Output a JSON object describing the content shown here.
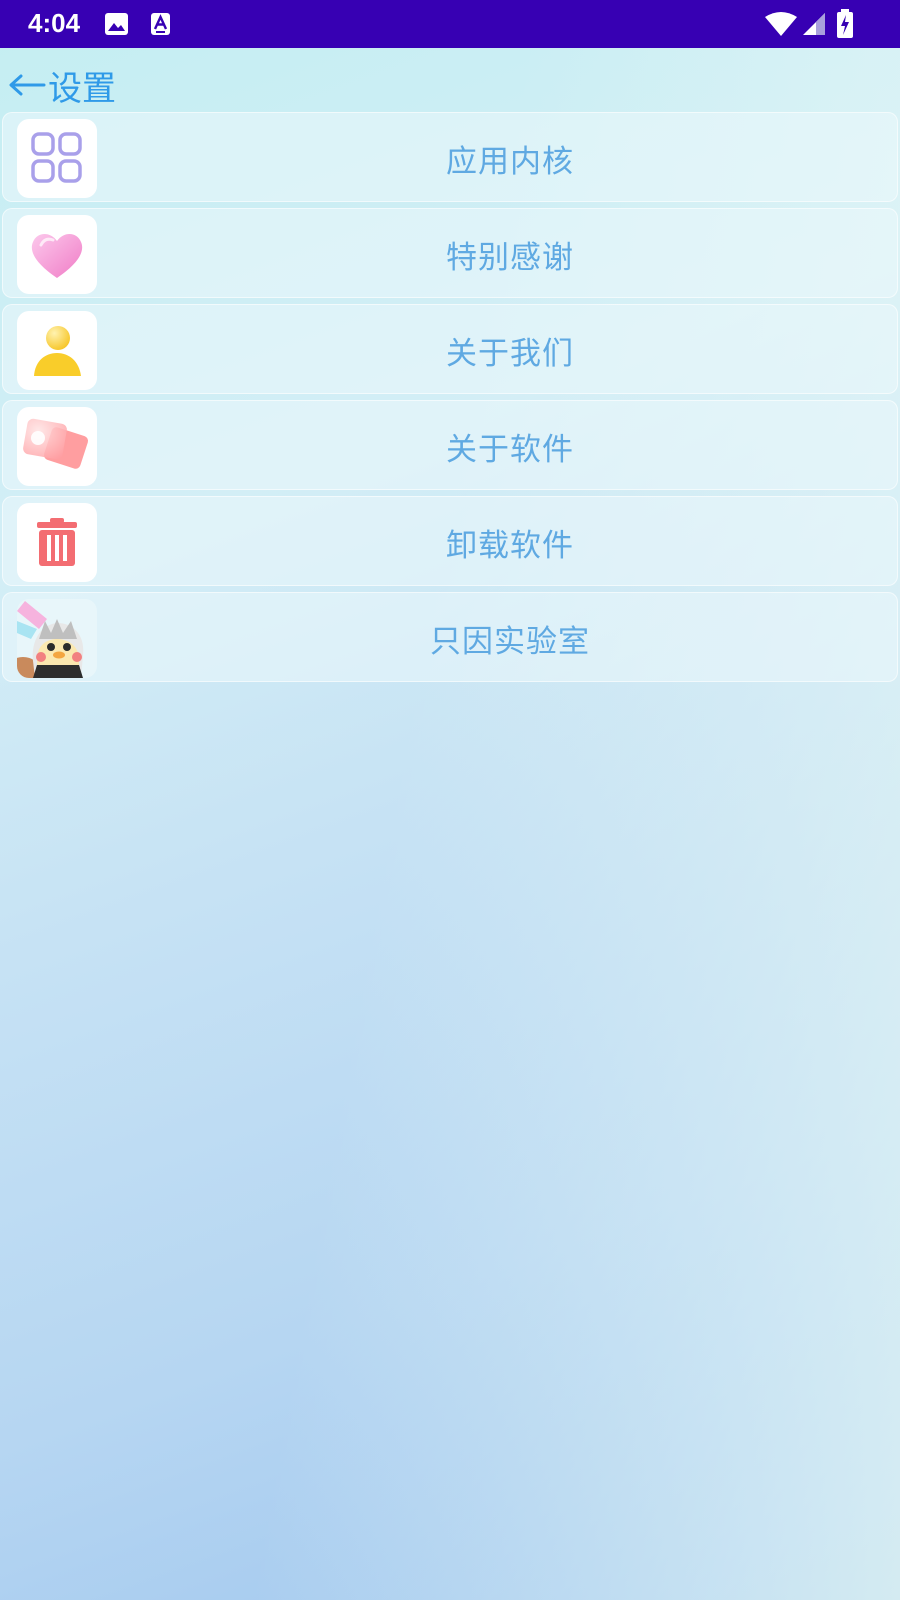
{
  "status_bar": {
    "time": "4:04",
    "icons": [
      "image-icon",
      "text-a-icon",
      "wifi-icon",
      "signal-icon",
      "battery-charging-icon"
    ]
  },
  "header": {
    "back_icon": "arrow-left-icon",
    "title": "设置"
  },
  "menu": {
    "items": [
      {
        "label": "应用内核",
        "icon": "grid-icon"
      },
      {
        "label": "特别感谢",
        "icon": "heart-icon"
      },
      {
        "label": "关于我们",
        "icon": "person-icon"
      },
      {
        "label": "关于软件",
        "icon": "cards-icon"
      },
      {
        "label": "卸载软件",
        "icon": "trash-icon"
      },
      {
        "label": "只因实验室",
        "icon": "mascot-icon"
      }
    ]
  },
  "colors": {
    "status_bar": "#3700b3",
    "title": "#2f9ae8",
    "label": "#5fa9e2"
  }
}
